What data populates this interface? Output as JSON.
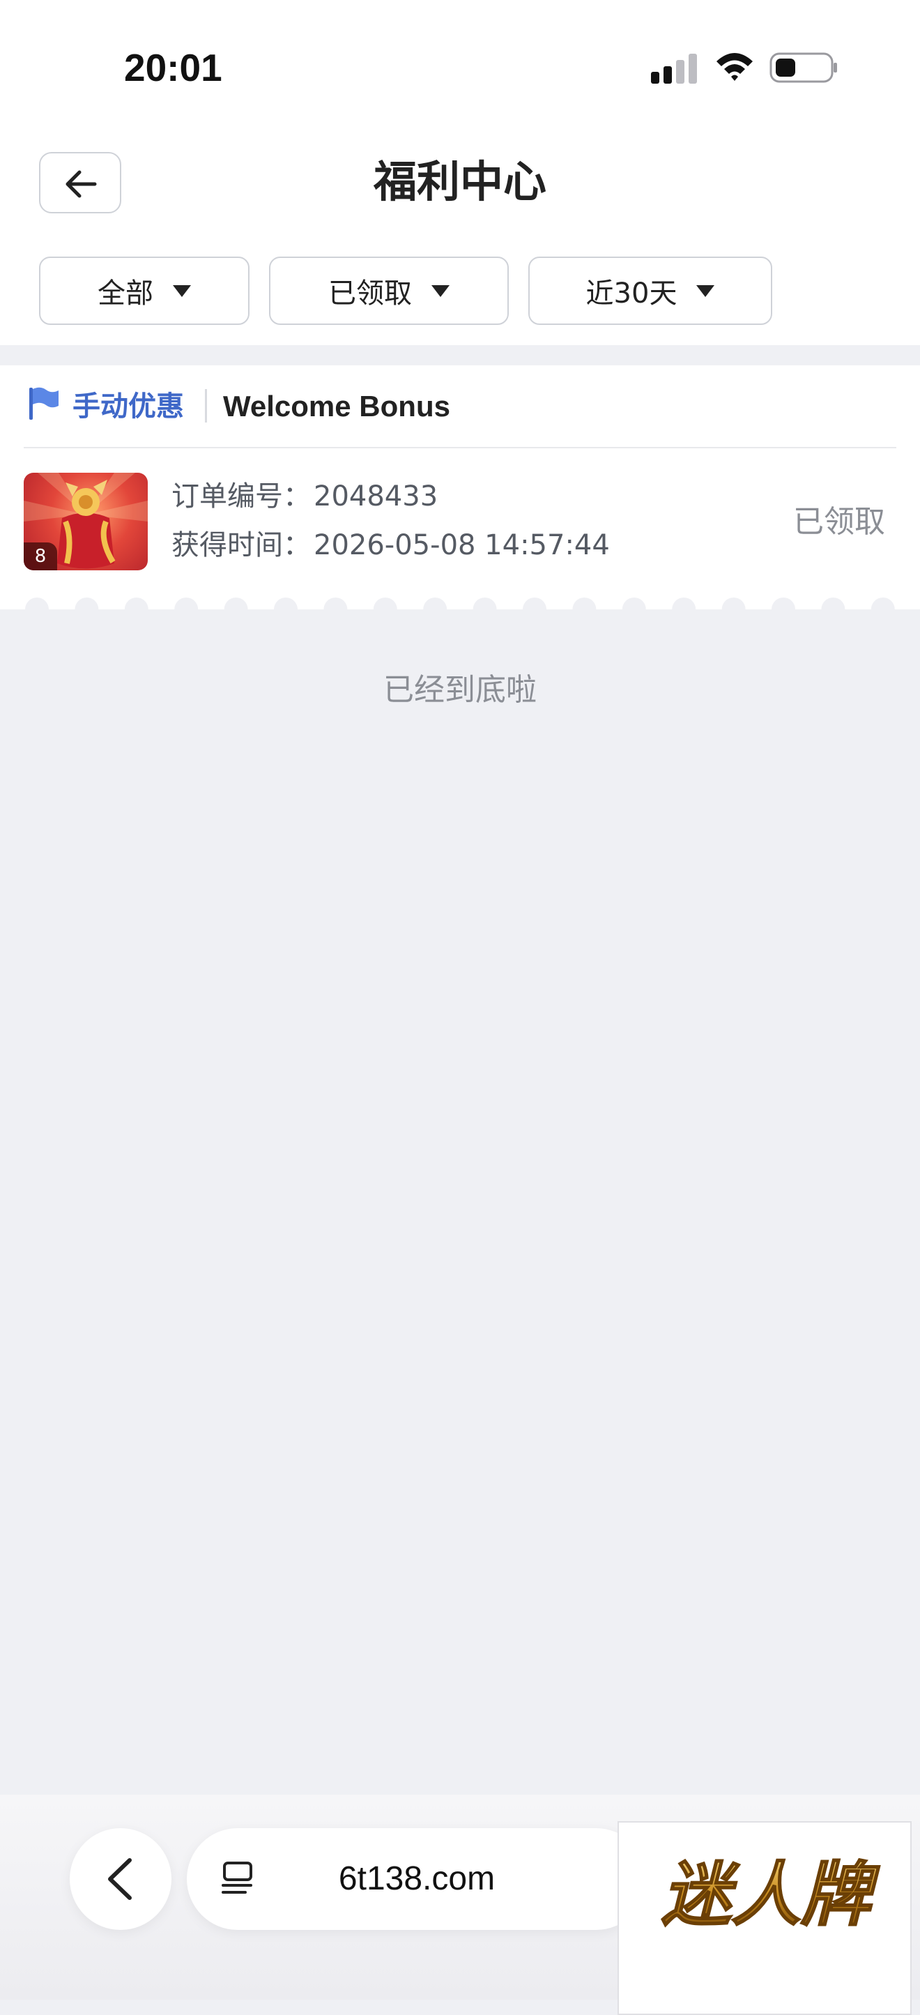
{
  "status_bar": {
    "time": "20:01",
    "icons": [
      "signal-icon",
      "wifi-icon",
      "battery-icon"
    ]
  },
  "header": {
    "title": "福利中心",
    "back_icon": "arrow-left-icon"
  },
  "filters": [
    {
      "label": "全部",
      "icon": "caret-down-icon"
    },
    {
      "label": "已领取",
      "icon": "caret-down-icon"
    },
    {
      "label": "近30天",
      "icon": "caret-down-icon"
    }
  ],
  "card": {
    "category": "手动优惠",
    "category_icon": "flag-icon",
    "bonus_name": "Welcome Bonus",
    "thumbnail_badge": "8",
    "order_label": "订单编号：",
    "order_value": "2048433",
    "time_label": "获得时间：",
    "time_value": "2026-05-08 14:57:44",
    "status": "已领取"
  },
  "end_text": "已经到底啦",
  "browser": {
    "back_icon": "chevron-left-icon",
    "tabs_icon": "tabs-icon",
    "url": "6t138.com"
  },
  "ad": {
    "logo_text": "迷人牌"
  },
  "colors": {
    "accent_blue": "#3f68c8",
    "page_background": "#eff0f4",
    "muted_text": "#8b8e95"
  }
}
